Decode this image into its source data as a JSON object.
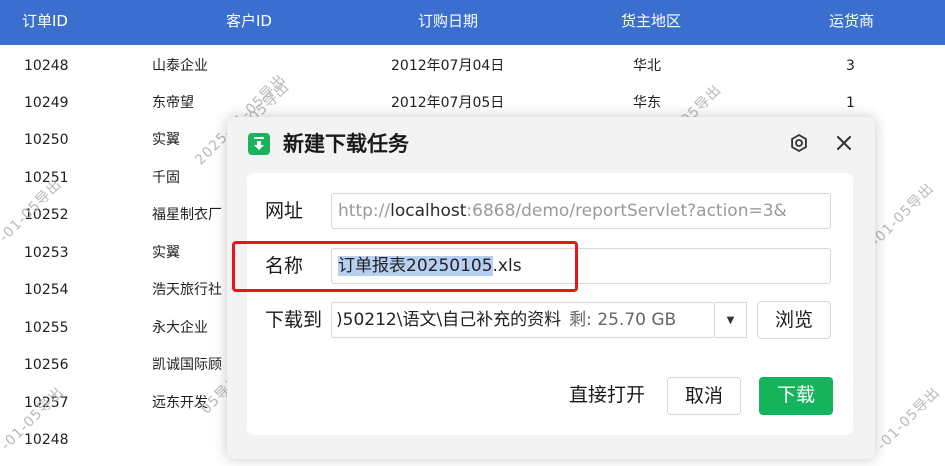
{
  "table": {
    "headers": [
      "订单ID",
      "客户ID",
      "订购日期",
      "货主地区",
      "运货商"
    ],
    "rows": [
      {
        "id": "10248",
        "customer": "山泰企业",
        "date": "2012年07月04日",
        "region": "华北",
        "shipper": "3"
      },
      {
        "id": "10249",
        "customer": "东帝望",
        "date": "2012年07月05日",
        "region": "华东",
        "shipper": "1"
      },
      {
        "id": "10250",
        "customer": "实翼",
        "date": "",
        "region": "",
        "shipper": ""
      },
      {
        "id": "10251",
        "customer": "千固",
        "date": "",
        "region": "",
        "shipper": ""
      },
      {
        "id": "10252",
        "customer": "福星制衣厂",
        "date": "",
        "region": "",
        "shipper": ""
      },
      {
        "id": "10253",
        "customer": "实翼",
        "date": "",
        "region": "",
        "shipper": ""
      },
      {
        "id": "10254",
        "customer": "浩天旅行社",
        "date": "",
        "region": "",
        "shipper": ""
      },
      {
        "id": "10255",
        "customer": "永大企业",
        "date": "",
        "region": "",
        "shipper": ""
      },
      {
        "id": "10256",
        "customer": "凯诚国际顾",
        "date": "",
        "region": "",
        "shipper": ""
      },
      {
        "id": "10257",
        "customer": "远东开发",
        "date": "",
        "region": "",
        "shipper": ""
      },
      {
        "id": "10248",
        "customer": "",
        "date": "",
        "region": "",
        "shipper": ""
      }
    ]
  },
  "watermark": {
    "text_a": "2025-01-05导出",
    "text_b": "-01-05导出",
    "text_c": "05导出"
  },
  "dialog": {
    "title": "新建下载任务",
    "url_label": "网址",
    "url_prefix": "http://",
    "url_host": "localhost",
    "url_rest": ":6868/demo/reportServlet?action=3&",
    "name_label": "名称",
    "name_selected": "订单报表20250105",
    "name_ext": ".xls",
    "path_label": "下载到",
    "path_value": ")50212\\语文\\自己补充的资料",
    "space_info": "剩: 25.70 GB",
    "browse_label": "浏览",
    "open_label": "直接打开",
    "cancel_label": "取消",
    "download_label": "下载",
    "icons": {
      "logo": "download-app-logo",
      "settings": "gear-icon",
      "close": "close-icon",
      "dropdown": "chevron-down-icon"
    }
  },
  "colors": {
    "header_bg": "#3b6fcf",
    "download_btn": "#15b35b",
    "highlight_box": "#e8161b",
    "selection": "#b7d0f1"
  }
}
